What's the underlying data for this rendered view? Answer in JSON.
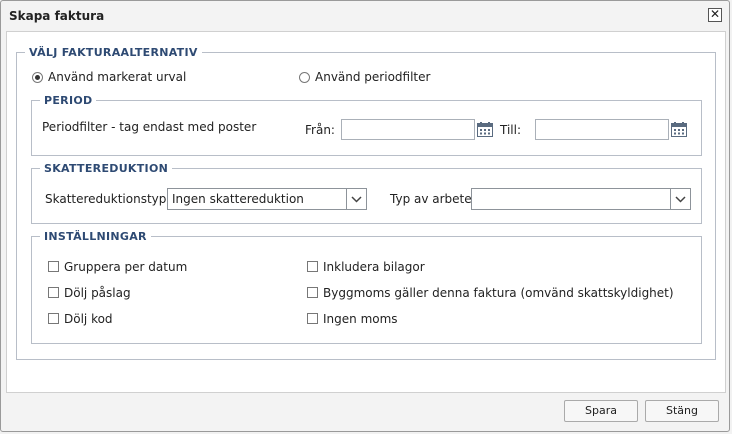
{
  "dialog": {
    "title": "Skapa faktura",
    "close_glyph": "✕"
  },
  "invoice_options": {
    "legend": "VÄLJ FAKTURAALTERNATIV",
    "radio_selected_label": "Använd markerat urval",
    "radio_period_label": "Använd periodfilter",
    "selected_option": "Använd markerat urval"
  },
  "period": {
    "legend": "PERIOD",
    "description": "Periodfilter - tag endast med poster",
    "from_label": "Från:",
    "from_value": "",
    "to_label": "Till:",
    "to_value": ""
  },
  "tax_reduction": {
    "legend": "SKATTEREDUKTION",
    "type_label": "Skattereduktionstyp:",
    "type_value": "Ingen skattereduktion",
    "work_label": "Typ av arbete:",
    "work_value": ""
  },
  "settings": {
    "legend": "INSTÄLLNINGAR",
    "checkboxes": [
      {
        "label": "Gruppera per datum",
        "checked": false
      },
      {
        "label": "Dölj påslag",
        "checked": false
      },
      {
        "label": "Dölj kod",
        "checked": false
      },
      {
        "label": "Inkludera bilagor",
        "checked": false
      },
      {
        "label": "Byggmoms gäller denna faktura (omvänd skattskyldighet)",
        "checked": false
      },
      {
        "label": "Ingen moms",
        "checked": false
      }
    ]
  },
  "buttons": {
    "save_label": "Spara",
    "close_label": "Stäng"
  },
  "icons": {
    "calendar": "calendar-icon",
    "dropdown": "chevron-down-icon",
    "close": "close-icon"
  },
  "colors": {
    "legend": "#2e4a73",
    "fieldset_border": "#b8bec8"
  }
}
